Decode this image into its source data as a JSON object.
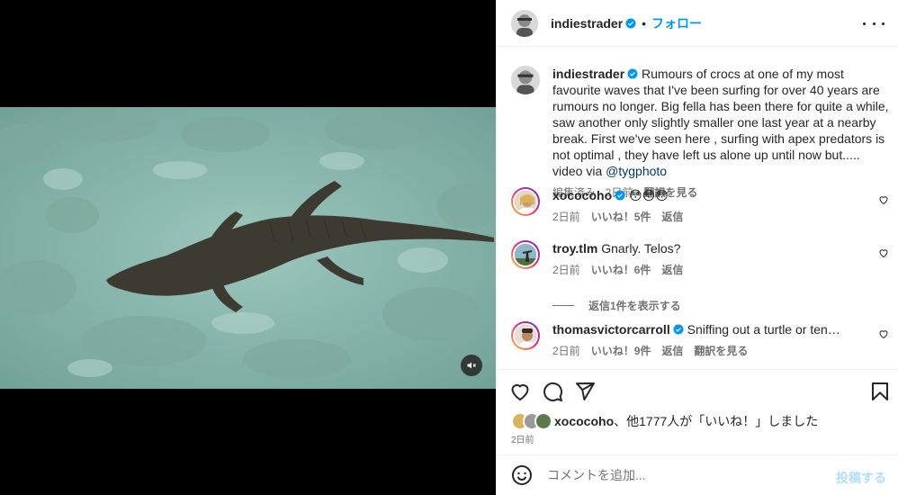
{
  "post": {
    "author": "indiestrader",
    "follow_label": "フォロー",
    "dot": "•",
    "caption_text": " Rumours of crocs at one of my most favourite waves that I've been surfing for over 40 years are rumours no longer. Big fella has been there for quite a while, saw another only slightly smaller one last year at a nearby break. First we've seen here , surfing with apex predators is not optimal , they have left us alone up until now but..... video via ",
    "caption_mention": "@tygphoto",
    "caption_meta": {
      "edited_time": "編集済み · 2日前",
      "translate": "翻訳を見る"
    }
  },
  "comments": [
    {
      "username": "xococoho",
      "verified": true,
      "text": "😳😳😳",
      "time": "2日前",
      "likes": "いいね！5件",
      "reply": "返信"
    },
    {
      "username": "troy.tlm",
      "verified": false,
      "text": "Gnarly. Telos?",
      "time": "2日前",
      "likes": "いいね！6件",
      "reply": "返信"
    },
    {
      "username": "thomasvictorcarroll",
      "verified": true,
      "text": "Sniffing out a turtle or ten…",
      "time": "2日前",
      "likes": "いいね！9件",
      "reply": "返信",
      "translate": "翻訳を見る"
    }
  ],
  "view_replies": "返信1件を表示する",
  "likes_summary": {
    "user": "xococoho",
    "rest": "、他1777人が「いいね！」しました"
  },
  "post_time": "2日前",
  "add_comment": {
    "placeholder": "コメントを追加...",
    "post_label": "投稿する"
  },
  "icons": {
    "verified": "verified-badge-icon",
    "more": "more-options-icon",
    "mute": "muted-speaker-icon",
    "like": "heart-icon",
    "comment": "comment-bubble-icon",
    "share": "paper-plane-icon",
    "save": "bookmark-icon",
    "emoji": "emoji-smiley-icon"
  },
  "colors": {
    "link_blue": "#0095f6",
    "verified_blue": "#0095f6",
    "mention": "#00376b",
    "muted_text": "#737373",
    "post_disabled": "#b2dffc"
  }
}
